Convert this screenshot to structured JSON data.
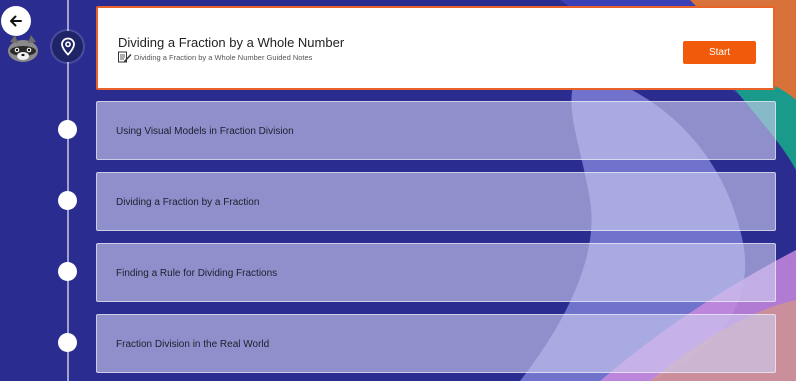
{
  "header": {
    "back_icon": "arrow-left-icon",
    "avatar_icon": "raccoon-avatar"
  },
  "active_lesson": {
    "title": "Dividing a Fraction by a Whole Number",
    "notes_icon": "pencil-notes-icon",
    "notes_label": "Dividing a Fraction by a Whole Number Guided Notes",
    "start_label": "Start",
    "marker_icon": "location-pin-icon"
  },
  "lessons": [
    {
      "label": "Using Visual Models in Fraction Division"
    },
    {
      "label": "Dividing a Fraction by a Fraction"
    },
    {
      "label": "Finding a Rule for Dividing Fractions"
    },
    {
      "label": "Fraction Division in the Real World"
    }
  ],
  "colors": {
    "background": "#2a2d8f",
    "accent": "#f15a0a",
    "active_border": "#e8622a"
  }
}
